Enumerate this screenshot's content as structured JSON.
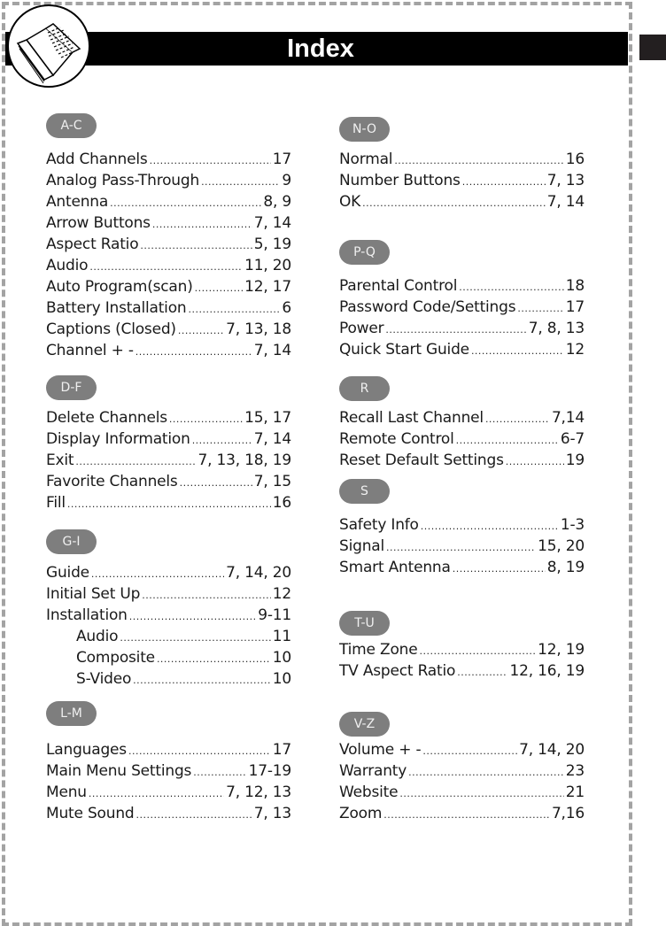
{
  "header": {
    "title": "Index",
    "icon": "open-book-icon"
  },
  "side_tab": {
    "color": "#231f20"
  },
  "colors": {
    "pill_background": "#7e7e7e",
    "pill_text": "#f0f0f0",
    "border": "#a3a3a3",
    "header_bar": "#000000"
  },
  "sections": [
    {
      "label": "A-C",
      "entries": [
        {
          "name": "Add Channels",
          "pages": "17"
        },
        {
          "name": "Analog Pass-Through",
          "pages": "9"
        },
        {
          "name": "Antenna",
          "pages": "8, 9"
        },
        {
          "name": "Arrow Buttons",
          "pages": "7, 14"
        },
        {
          "name": "Aspect Ratio",
          "pages": "5, 19"
        },
        {
          "name": "Audio",
          "pages": "11, 20"
        },
        {
          "name": "Auto Program(scan)",
          "pages": "12, 17"
        },
        {
          "name": "Battery Installation",
          "pages": "6"
        },
        {
          "name": "Captions (Closed)",
          "pages": "7, 13, 18"
        },
        {
          "name": "Channel + -",
          "pages": "7, 14"
        }
      ]
    },
    {
      "label": "D-F",
      "entries": [
        {
          "name": "Delete Channels",
          "pages": "15, 17"
        },
        {
          "name": "Display Information",
          "pages": "7, 14"
        },
        {
          "name": "Exit",
          "pages": "7, 13, 18, 19"
        },
        {
          "name": "Favorite Channels",
          "pages": "7, 15"
        },
        {
          "name": "Fill",
          "pages": "16"
        }
      ]
    },
    {
      "label": "G-I",
      "entries": [
        {
          "name": "Guide",
          "pages": "7, 14, 20"
        },
        {
          "name": "Initial Set Up",
          "pages": "12"
        },
        {
          "name": "Installation",
          "pages": "9-11"
        },
        {
          "name": "Audio",
          "pages": "11",
          "sub": true
        },
        {
          "name": "Composite",
          "pages": "10",
          "sub": true
        },
        {
          "name": "S-Video",
          "pages": "10",
          "sub": true
        }
      ]
    },
    {
      "label": "L-M",
      "entries": [
        {
          "name": "Languages",
          "pages": "17"
        },
        {
          "name": "Main Menu Settings",
          "pages": "17-19"
        },
        {
          "name": "Menu",
          "pages": "7, 12, 13"
        },
        {
          "name": "Mute Sound",
          "pages": "7, 13"
        }
      ]
    },
    {
      "label": "N-O",
      "entries": [
        {
          "name": "Normal",
          "pages": "16"
        },
        {
          "name": "Number Buttons",
          "pages": "7, 13"
        },
        {
          "name": "OK",
          "pages": "7, 14"
        }
      ]
    },
    {
      "label": "P-Q",
      "entries": [
        {
          "name": "Parental Control",
          "pages": "18"
        },
        {
          "name": "Password Code/Settings",
          "pages": "17"
        },
        {
          "name": "Power",
          "pages": "7, 8, 13"
        },
        {
          "name": "Quick Start Guide",
          "pages": "12"
        }
      ]
    },
    {
      "label": "R",
      "entries": [
        {
          "name": "Recall Last Channel",
          "pages": "7,14"
        },
        {
          "name": "Remote Control",
          "pages": "6-7"
        },
        {
          "name": "Reset Default Settings",
          "pages": "19"
        }
      ]
    },
    {
      "label": "S",
      "entries": [
        {
          "name": "Safety Info",
          "pages": "1-3"
        },
        {
          "name": "Signal",
          "pages": "15, 20"
        },
        {
          "name": "Smart Antenna",
          "pages": "8, 19"
        }
      ]
    },
    {
      "label": "T-U",
      "entries": [
        {
          "name": "Time Zone",
          "pages": "12, 19"
        },
        {
          "name": "TV Aspect Ratio",
          "pages": "12, 16, 19"
        }
      ]
    },
    {
      "label": "V-Z",
      "entries": [
        {
          "name": "Volume + -",
          "pages": "7, 14, 20"
        },
        {
          "name": "Warranty",
          "pages": "23"
        },
        {
          "name": "Website",
          "pages": "21"
        },
        {
          "name": "Zoom",
          "pages": "7,16"
        }
      ]
    }
  ]
}
